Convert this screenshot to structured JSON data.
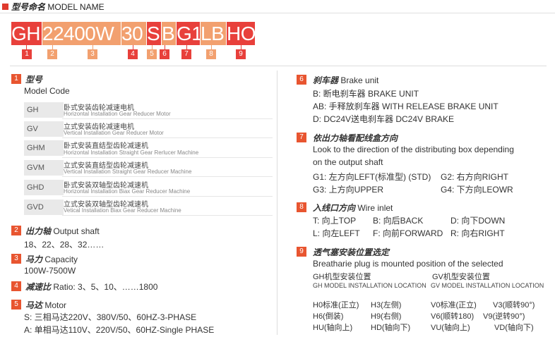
{
  "title": {
    "cn": "型号命名",
    "en": "MODEL NAME"
  },
  "model_code": {
    "segments": [
      "GH",
      "22400W",
      "30",
      "S",
      "B",
      "G1",
      "LB",
      "HO"
    ],
    "colors": [
      "#e8403b",
      "#f2a06f",
      "#f2a06f",
      "#e8403b",
      "#f2a06f",
      "#e8403b",
      "#f2a06f",
      "#e8403b"
    ],
    "numbers": [
      "1",
      "2",
      "3",
      "4",
      "5",
      "6",
      "7",
      "8",
      "9"
    ]
  },
  "s1": {
    "num": "1",
    "title_cn": "型号",
    "title_en": "Model Code",
    "rows": [
      {
        "code": "GH",
        "cn": "卧式安装齿轮减速电机",
        "en": "Horizontal Installation Gear Reducer Motor"
      },
      {
        "code": "GV",
        "cn": "立式安装齿轮减速电机",
        "en": "Vertical Installation Gear Reducer Motor"
      },
      {
        "code": "GHM",
        "cn": "卧式安装直结型齿轮减速机",
        "en": "Horizontal Installation Straight Gear Rerlucer Machine"
      },
      {
        "code": "GVM",
        "cn": "立式安装直结型齿轮减速机",
        "en": "Vertical Installation Straight Gear Reducer Machine"
      },
      {
        "code": "GHD",
        "cn": "卧式安装双轴型齿轮减速机",
        "en": "Horizontal Installation Biax Gear Reducer Machine"
      },
      {
        "code": "GVD",
        "cn": "立式安装双轴型齿轮减速机",
        "en": "Vetical Installation Biax Gear Reducer Machine"
      }
    ]
  },
  "s2": {
    "num": "2",
    "title_cn": "出力轴",
    "title_en": "Output shaft",
    "text": "18、22、28、32……"
  },
  "s3": {
    "num": "3",
    "title_cn": "马力",
    "title_en": "Capacity",
    "text": "100W-7500W"
  },
  "s4": {
    "num": "4",
    "title_cn": "减速比",
    "title_en": "Ratio: 3、5、10、……1800"
  },
  "s5": {
    "num": "5",
    "title_cn": "马达",
    "title_en": "Motor",
    "lines": [
      "S: 三相马达220V、380V/50、60HZ-3-PHASE",
      "A: 单相马达110V、220V/50、60HZ-Single PHASE"
    ]
  },
  "s6": {
    "num": "6",
    "title_cn": "刹车器",
    "title_en": "Brake unit",
    "lines": [
      "B: 断电刹车器 BRAKE UNIT",
      "AB: 手释放刹车器 WITH RELEASE BRAKE UNIT",
      "D: DC24V送电刹车器 DC24V BRAKE"
    ]
  },
  "s7": {
    "num": "7",
    "title_cn": "依出力轴看配线盒方向",
    "lines": [
      "Look to the direction of the distributing box depending",
      "on the output shaft"
    ],
    "g1": "G1: 左方向LEFT(标准型) (STD)",
    "g2": "G2: 右方向RIGHT",
    "g3": "G3: 上方向UPPER",
    "g4": "G4: 下方向LEOWR"
  },
  "s8": {
    "num": "8",
    "title_cn": "入线口方向",
    "title_en": "Wire inlet",
    "t": "T: 向上TOP",
    "b": "B: 向后BACK",
    "d": "D: 向下DOWN",
    "l": "L: 向左LEFT",
    "f": "F: 向前FORWARD",
    "r": "R: 向右RIGHT"
  },
  "s9": {
    "num": "9",
    "title_cn": "透气塞安装位置选定",
    "line1": "Breatharie plug is mounted position of the selected",
    "gh_cn": "GH机型安装位置",
    "gv_cn": "GV机型安装位置",
    "gh_en": "GH MODEL INSTALLATION LOCATION",
    "gv_en": "GV MODEL INSTALLATION LOCATION",
    "h0": "H0标准(正立)",
    "h3": "H3(左侧)",
    "v0": "V0标准(正立)",
    "v3": "V3(顺转90°)",
    "h6": "H6(倒装)",
    "h9": "H9(右侧)",
    "v6": "V6(顺转180)",
    "v9": "V9(逆转90°)",
    "hu": "HU(轴向上)",
    "hd": "HD(轴向下)",
    "vu": "VU(轴向上)",
    "vd": "VD(轴向下)"
  }
}
